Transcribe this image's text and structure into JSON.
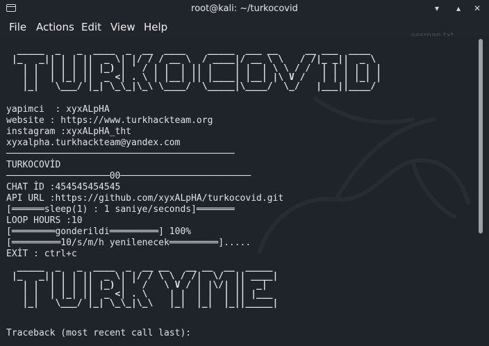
{
  "window": {
    "title": "root@kali: ~/turkocovid"
  },
  "menu": [
    "File",
    "Actions",
    "Edit",
    "View",
    "Help"
  ],
  "desktop_hint": "sesman.txt",
  "icons": {
    "terminal": "terminal-icon",
    "minimize": "minimize-icon",
    "maximize": "maximize-icon",
    "close": "close-icon"
  },
  "banner1": "  _____  _   _  ____  _  __  ____    _____  ___ __     __ ___  ____  \n |_   _|| | | ||  _ \\| |/ / / __ \\  / ____|/ __ \\ \\   / /|_ _||  _ \\ \n   | |  | | | || |_) | ' / | |  | || |    | |  | \\ \\ / /  | | | | | |\n   | |  | |_| ||  _ <| . \\ | |__| || |____| |__| |\\ V /   | | | |_| |\n   |_|   \\___/ |_| \\_\\_|\\_\\ \\____/  \\_____|\\____/  \\_/   |___||____/ ",
  "banner2": "  _____  _   _  ____  _  __ __   __ __  __  _____ \n |_   _|| | | ||  _ \\| |/ / \\ \\ / /|  \\/  || ____|\n   | |  | | | || |_) | ' /   \\ V / | |\\/| ||  _|  \n   | |  | |_| ||  _ <| . \\    | |  | |  | || |___ \n   |_|   \\___/ |_| \\_\\_|\\_\\   |_|  |_|  |_||_____|",
  "lines": [
    "yapimci  : xyxALpHA",
    "website : https://www.turkhackteam.org",
    "instagram :xyxALpHA_tht",
    "xyxalpha.turkhackteam@yandex.com",
    "──────────────────────────────────────────",
    "TURKOCOVİD",
    "───────────────────00────────────────────────",
    "CHAT İD :454545454545",
    "API URL :https://github.com/xyxALpHA/turkocovid.git",
    "[══════sleep(1) : 1 saniye/seconds]═══════",
    "LOOP HOURS :10",
    "[════════gonderildi═════════] 100%",
    "[═════════10/s/m/h yenilenecek═════════].....",
    "EXİT : ctrl+c",
    "Traceback (most recent call last):"
  ]
}
